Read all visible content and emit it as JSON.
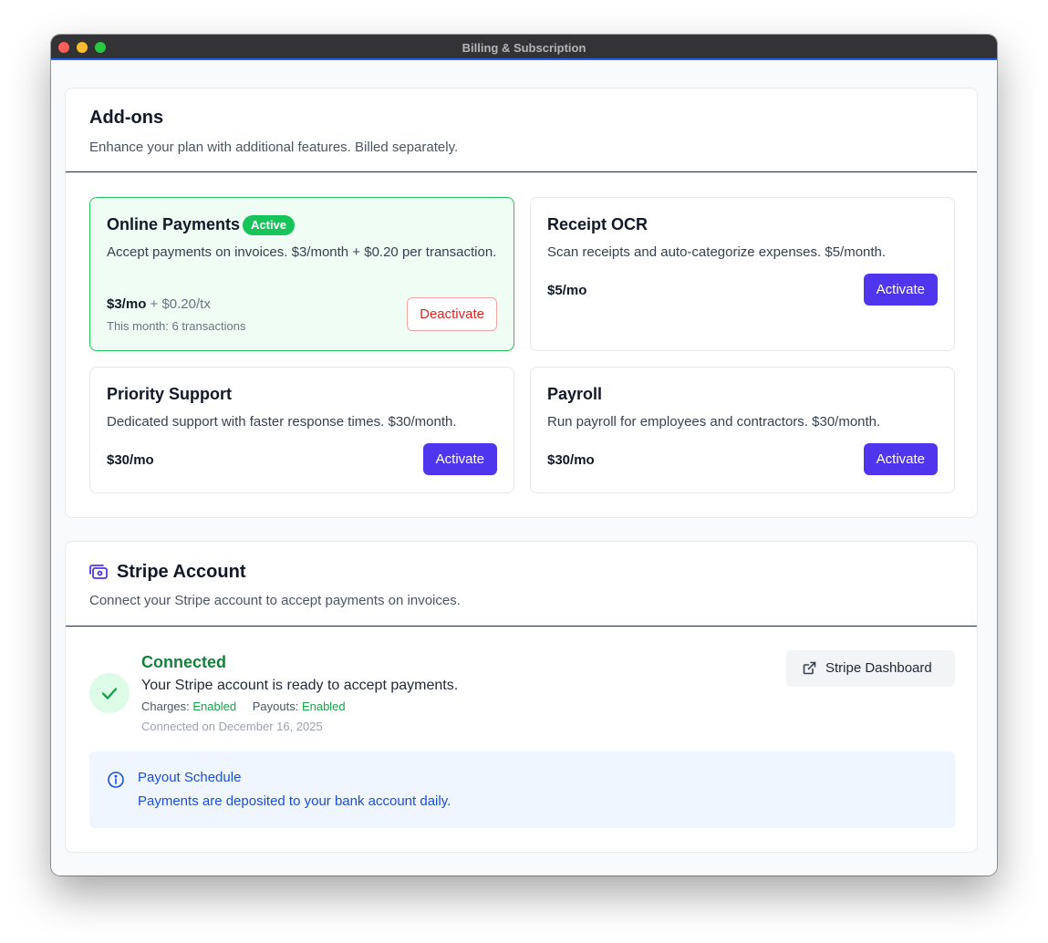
{
  "window": {
    "title": "Billing & Subscription"
  },
  "addons": {
    "title": "Add-ons",
    "description": "Enhance your plan with additional features. Billed separately.",
    "items": [
      {
        "name": "Online Payments",
        "badge": "Active",
        "description": "Accept payments on invoices. $3/month + $0.20 per transaction.",
        "price": "$3/mo",
        "price_extra": " + $0.20/tx",
        "usage": "This month: 6 transactions",
        "action": "Deactivate",
        "active": true
      },
      {
        "name": "Receipt OCR",
        "description": "Scan receipts and auto-categorize expenses. $5/month.",
        "price": "$5/mo",
        "action": "Activate",
        "active": false
      },
      {
        "name": "Priority Support",
        "description": "Dedicated support with faster response times. $30/month.",
        "price": "$30/mo",
        "action": "Activate",
        "active": false
      },
      {
        "name": "Payroll",
        "description": "Run payroll for employees and contractors. $30/month.",
        "price": "$30/mo",
        "action": "Activate",
        "active": false
      }
    ]
  },
  "stripe": {
    "title": "Stripe Account",
    "description": "Connect your Stripe account to accept payments on invoices.",
    "status": "Connected",
    "message": "Your Stripe account is ready to accept payments.",
    "charges_label": "Charges:",
    "charges_value": "Enabled",
    "payouts_label": "Payouts:",
    "payouts_value": "Enabled",
    "connected_on": "Connected on December 16, 2025",
    "dashboard_button": "Stripe Dashboard",
    "payout_schedule": {
      "title": "Payout Schedule",
      "text": "Payments are deposited to your bank account daily."
    }
  },
  "colors": {
    "accent": "#4f35ee",
    "success": "#16a34a",
    "danger": "#dc2626",
    "info": "#1d4ed8"
  },
  "icons": {
    "stripe_header": "banknote-icon",
    "connected": "check-icon",
    "dashboard": "external-link-icon",
    "payout_info": "info-icon"
  }
}
